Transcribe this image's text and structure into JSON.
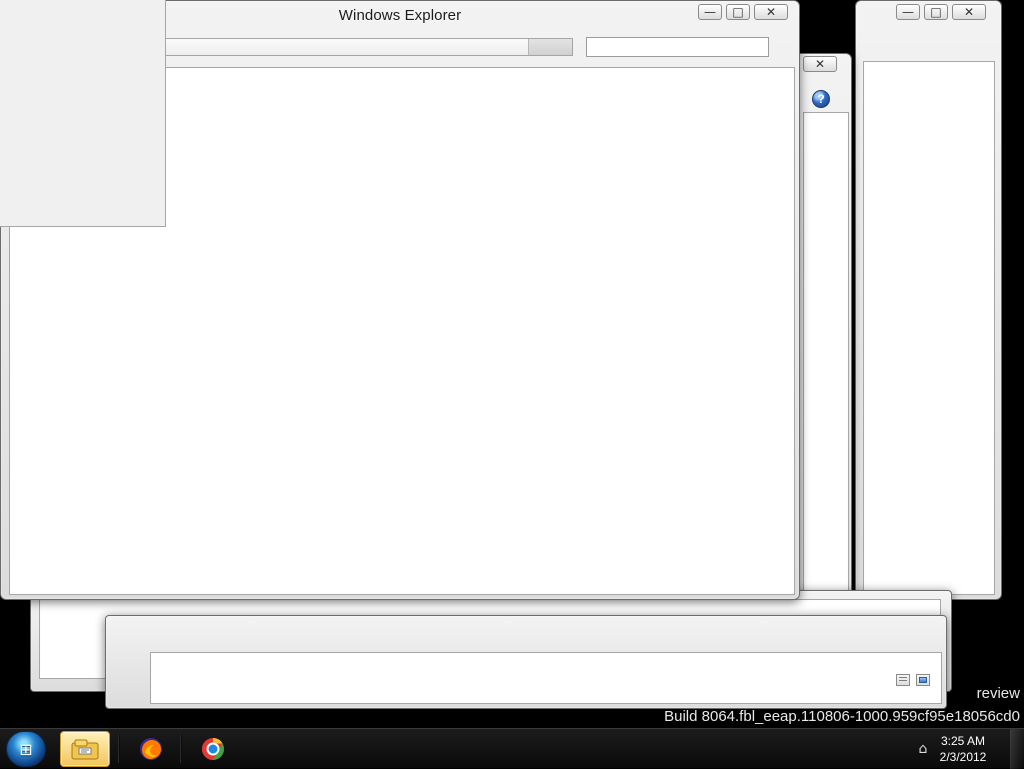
{
  "window": {
    "title": "Windows Explorer"
  },
  "watermark": {
    "line1": "review",
    "line2": "Build 8064.fbl_eeap.110806-1000.959cf95e18056cd0"
  },
  "taskbar": {
    "time": "3:25 AM",
    "date": "2/3/2012"
  },
  "icons": {
    "start": "windows-start-icon",
    "explorer": "windows-explorer-icon",
    "firefox": "firefox-icon",
    "chrome": "chrome-icon",
    "network": "network-icon",
    "help": "help-icon",
    "details_view": "details-view-icon",
    "preview_view": "preview-view-icon"
  }
}
